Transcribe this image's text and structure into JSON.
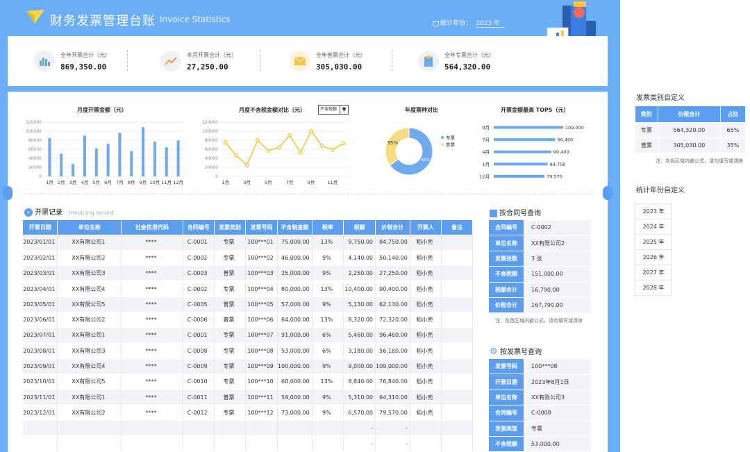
{
  "header": {
    "title": "财务发票管理台账",
    "subtitle": "Invoice Statistics",
    "year_label": "统计年份：",
    "year_value": "2023 年"
  },
  "kpis": [
    {
      "label": "全年开票合计（元）",
      "value": "869,350.00",
      "icon": "bar-chart-icon"
    },
    {
      "label": "本月开票合计（元）",
      "value": "27,250.00",
      "icon": "trend-line-icon"
    },
    {
      "label": "全年普票合计（元）",
      "value": "305,030.00",
      "icon": "envelope-icon"
    },
    {
      "label": "全年专票合计（元）",
      "value": "564,320.00",
      "icon": "clipboard-icon"
    }
  ],
  "charts": {
    "monthly_title": "月度开票金额（元）",
    "pretax_title": "月度不含税金额对比（元）",
    "pretax_dropdown": "不含税额",
    "pie_title": "年度票种对比",
    "top5_title": "开票金额最高 TOP5（元）"
  },
  "chart_data": [
    {
      "type": "bar",
      "title": "月度开票金额（元）",
      "categories": [
        "1月",
        "2月",
        "3月",
        "4月",
        "5月",
        "6月",
        "7月",
        "8月",
        "9月",
        "10月",
        "11月",
        "12月"
      ],
      "values": [
        84750,
        50140,
        27250,
        90400,
        62130,
        72320,
        96460,
        56180,
        109000,
        76840,
        64310,
        79570
      ],
      "yticks": [
        "0",
        "20000",
        "40000",
        "60000",
        "80000",
        "100000",
        "120000"
      ],
      "ylim": [
        0,
        120000
      ]
    },
    {
      "type": "line",
      "title": "月度不含税金额对比（元）",
      "categories": [
        "1月",
        "2月",
        "3月",
        "4月",
        "5月",
        "6月",
        "7月",
        "8月",
        "9月",
        "10月",
        "11月",
        "12月"
      ],
      "xticks": [
        "1月",
        "3月",
        "5月",
        "7月",
        "9月",
        "11月"
      ],
      "values": [
        75000,
        46000,
        25000,
        80000,
        57000,
        64000,
        91000,
        53000,
        100000,
        68000,
        59000,
        73000
      ],
      "yticks": [
        "0",
        "20000",
        "40000",
        "60000",
        "80000",
        "100000",
        "120000"
      ],
      "ylim": [
        0,
        120000
      ]
    },
    {
      "type": "pie",
      "title": "年度票种对比",
      "slices": [
        {
          "name": "专票",
          "value": 65,
          "label": "65%",
          "color": "#6fa9ee"
        },
        {
          "name": "普票",
          "value": 35,
          "label": "35%",
          "color": "#f9dc80"
        }
      ]
    },
    {
      "type": "bar",
      "title": "开票金额最高 TOP5（元）",
      "orientation": "horizontal",
      "categories": [
        "9月",
        "7月",
        "4月",
        "1月",
        "12月"
      ],
      "values": [
        109000,
        96460,
        90400,
        84750,
        79570
      ],
      "labels": [
        "109,000",
        "96,460",
        "90,400",
        "84,750",
        "79,570"
      ]
    }
  ],
  "records": {
    "title": "开票记录",
    "subtitle": "Invoicing record",
    "columns": [
      "开票日期",
      "单位名称",
      "社会信用代码",
      "合同编号",
      "发票类别",
      "发票号码",
      "不含税金额",
      "税率",
      "税额",
      "价税合计",
      "开票人",
      "备注"
    ],
    "rows": [
      [
        "2023/01/01",
        "XX有限公司1",
        "****",
        "C-0001",
        "专票",
        "100***01",
        "75,000.00",
        "13%",
        "9,750.00",
        "84,750.00",
        "稻小壳",
        ""
      ],
      [
        "2023/02/01",
        "XX有限公司2",
        "****",
        "C-0002",
        "专票",
        "100***02",
        "46,000.00",
        "9%",
        "4,140.00",
        "50,140.00",
        "稻小壳",
        ""
      ],
      [
        "2023/03/01",
        "XX有限公司3",
        "****",
        "C-0003",
        "普票",
        "100***03",
        "25,000.00",
        "9%",
        "2,250.00",
        "27,250.00",
        "稻小壳",
        ""
      ],
      [
        "2023/04/01",
        "XX有限公司4",
        "****",
        "C-0002",
        "专票",
        "100***04",
        "80,000.00",
        "13%",
        "10,400.00",
        "90,400.00",
        "稻小壳",
        ""
      ],
      [
        "2023/05/01",
        "XX有限公司5",
        "****",
        "C-0005",
        "普票",
        "100***05",
        "57,000.00",
        "9%",
        "5,130.00",
        "62,130.00",
        "稻小壳",
        ""
      ],
      [
        "2023/06/01",
        "XX有限公司2",
        "****",
        "C-0006",
        "普票",
        "100***06",
        "64,000.00",
        "13%",
        "8,320.00",
        "72,320.00",
        "稻小壳",
        ""
      ],
      [
        "2023/07/01",
        "XX有限公司1",
        "****",
        "C-0001",
        "专票",
        "100***07",
        "91,000.00",
        "6%",
        "5,460.00",
        "96,460.00",
        "稻小壳",
        ""
      ],
      [
        "2023/08/01",
        "XX有限公司3",
        "****",
        "C-0008",
        "专票",
        "100***08",
        "53,000.00",
        "6%",
        "3,180.00",
        "56,180.00",
        "稻小壳",
        ""
      ],
      [
        "2023/09/01",
        "XX有限公司4",
        "****",
        "C-0009",
        "专票",
        "100***09",
        "100,000.00",
        "9%",
        "9,000.00",
        "109,000.00",
        "稻小壳",
        ""
      ],
      [
        "2023/10/01",
        "XX有限公司5",
        "****",
        "C-0010",
        "专票",
        "100***10",
        "68,000.00",
        "13%",
        "8,840.00",
        "76,840.00",
        "稻小壳",
        ""
      ],
      [
        "2023/11/01",
        "XX有限公司1",
        "****",
        "C-0011",
        "普票",
        "100***11",
        "59,000.00",
        "9%",
        "5,310.00",
        "64,310.00",
        "稻小壳",
        ""
      ],
      [
        "2023/12/01",
        "XX有限公司2",
        "****",
        "C-0012",
        "专票",
        "100***12",
        "73,000.00",
        "9%",
        "6,570.00",
        "79,570.00",
        "稻小壳",
        ""
      ],
      [
        "",
        "",
        "",
        "",
        "",
        "",
        "",
        "",
        "-",
        "-",
        "",
        ""
      ],
      [
        "",
        "",
        "",
        "",
        "",
        "",
        "",
        "",
        "-",
        "-",
        "",
        ""
      ]
    ]
  },
  "contract_query": {
    "title": "按合同号查询",
    "rows": [
      {
        "k": "合同编号",
        "v": "C-0002"
      },
      {
        "k": "单位名称",
        "v": "XX有限公司2"
      },
      {
        "k": "发票张数",
        "v": "3 张"
      },
      {
        "k": "不含税额",
        "v": "151,000.00"
      },
      {
        "k": "税额合计",
        "v": "16,790.00"
      },
      {
        "k": "价税合计",
        "v": "167,790.00"
      }
    ],
    "note": "注：灰色区域内嵌公式，请勿填写或清除"
  },
  "invoice_query": {
    "title": "按发票号查询",
    "rows": [
      {
        "k": "发票号码",
        "v": "100***08"
      },
      {
        "k": "开票日期",
        "v": "2023年8月1日"
      },
      {
        "k": "单位名称",
        "v": "XX有限公司3"
      },
      {
        "k": "合同编号",
        "v": "C-0008"
      },
      {
        "k": "发票类型",
        "v": "专票"
      },
      {
        "k": "不含税额",
        "v": "53,000.00"
      }
    ]
  },
  "side": {
    "cat_title": "发票类别自定义",
    "cat_columns": [
      "类别",
      "价税合计",
      "占比"
    ],
    "cat_rows": [
      [
        "专票",
        "564,320.00",
        "65%"
      ],
      [
        "普票",
        "305,030.00",
        "35%"
      ]
    ],
    "cat_note": "注：灰色区域内嵌公式，请勿填写或清除",
    "year_title": "统计年份自定义",
    "years": [
      "2023 年",
      "2024 年",
      "2025 年",
      "2026 年",
      "2027 年",
      "2028 年"
    ]
  },
  "colors": {
    "accent": "#5b9ef0",
    "frame": "#6aaef7",
    "bar": "#6fa9ee",
    "line": "#f2c531",
    "pie_minor": "#f9dc80"
  }
}
